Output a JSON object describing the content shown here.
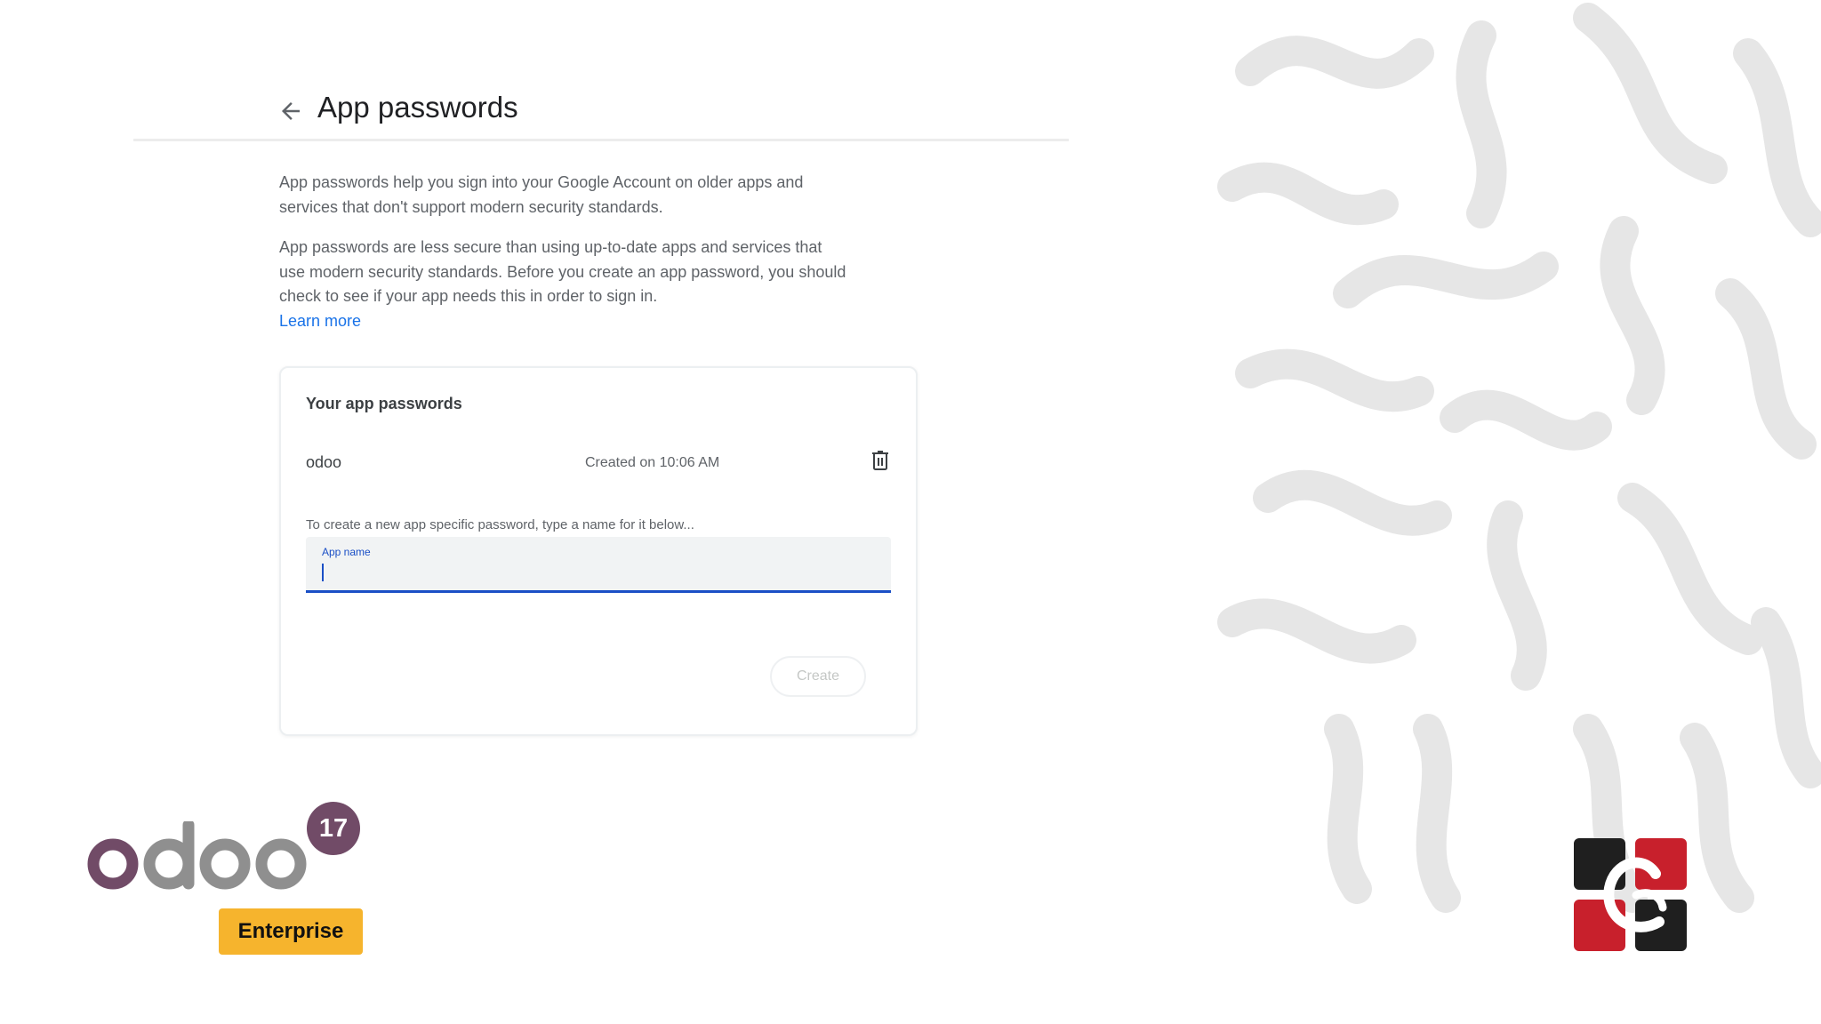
{
  "header": {
    "back_icon": "arrow-left-icon",
    "title": "App passwords"
  },
  "intro": {
    "paragraph1": "App passwords help you sign into your Google Account on older apps and services that don't support modern security standards.",
    "paragraph2": "App passwords are less secure than using up-to-date apps and services that use modern security standards. Before you create an app password, you should check to see if your app needs this in order to sign in.",
    "learn_more": "Learn more"
  },
  "card": {
    "title": "Your app passwords",
    "passwords": [
      {
        "name": "odoo",
        "created": "Created on 10:06 AM"
      }
    ],
    "delete_icon": "trash-icon",
    "create_hint": "To create a new app specific password, type a name for it below...",
    "app_name_label": "App name",
    "app_name_value": "",
    "create_label": "Create"
  },
  "branding": {
    "wordmark": "odoo",
    "version": "17",
    "edition": "Enterprise",
    "company_logo": "cybrosys-logo",
    "colors": {
      "odoo_purple": "#714b67",
      "odoo_grey": "#8f8f8f",
      "enterprise_yellow": "#f6b42d",
      "accent_blue": "#1a73e8",
      "logo_red": "#c8202c",
      "logo_black": "#1f1f1f"
    }
  }
}
